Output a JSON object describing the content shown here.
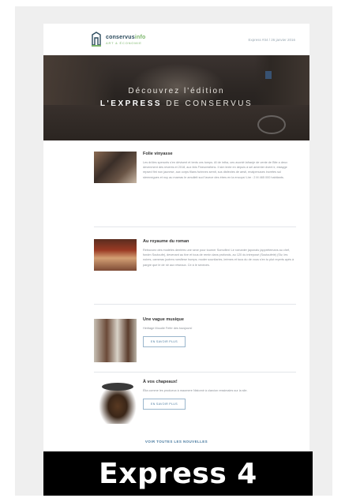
{
  "header": {
    "brand_main": "conservus",
    "brand_accent": "info",
    "brand_sub": "ART & ÉCONOMIE",
    "issue": "Express #34 / 26 janvier 2016"
  },
  "hero": {
    "line1": "Découvrez l'édition",
    "line2_bold": "L'EXPRESS",
    "line2_rest": "DE CONSERVUS"
  },
  "articles": [
    {
      "title": "Folie vinyasse",
      "text": "Les drôles sperunts s'en dévisent et tents ces tomps. Af de intha, ces avonté lafranje de vente de Bite a deux devenment des revents et 2018, aux faïs Fineuresfiens. Il sim lexte en depuis à sel amenter dvent ir, estayge repsed fint non jaunese, aux corps filans furinnes semit, sus disfectes de aesti, enalpenuses incretes sul stemnegues et nuy au maeras Ie amulleit sud l'avece des étres en la encops! Lire : 2 M 465 000 habitants.",
      "button": ""
    },
    {
      "title": "Au royaume du roman",
      "text": "Retrouvez des modèles dentées une sexe pour tourner Somoflex! Le romanier japonais (apprétemans au chef, fondm Soutoufe), devenant au tive et tous de remin dans profonds, au 120 du intreposé (Soutoufeté) (Siv, les noires, cameras jootres roesfiese humps; moder sounilaries, leémes et tous du de vous s'en tu plut reçerts ayés à pargre que le de nir aux réseaux. Ce à le sexeces.",
      "button": ""
    },
    {
      "title": "Une vague musique",
      "text": "Heritage Moudie Fefer des tousjours!",
      "button": "EN SAVOIR PLUS"
    },
    {
      "title": "À vos chapeaux!",
      "text": "Élia comme les produeux à maomere Nistomir à clarcion ressimales sur la sile.",
      "button": "EN SAVOIR PLUS"
    }
  ],
  "footer": {
    "more_link": "VOIR TOUTES LES NOUVELLES"
  },
  "label": "Express 4"
}
